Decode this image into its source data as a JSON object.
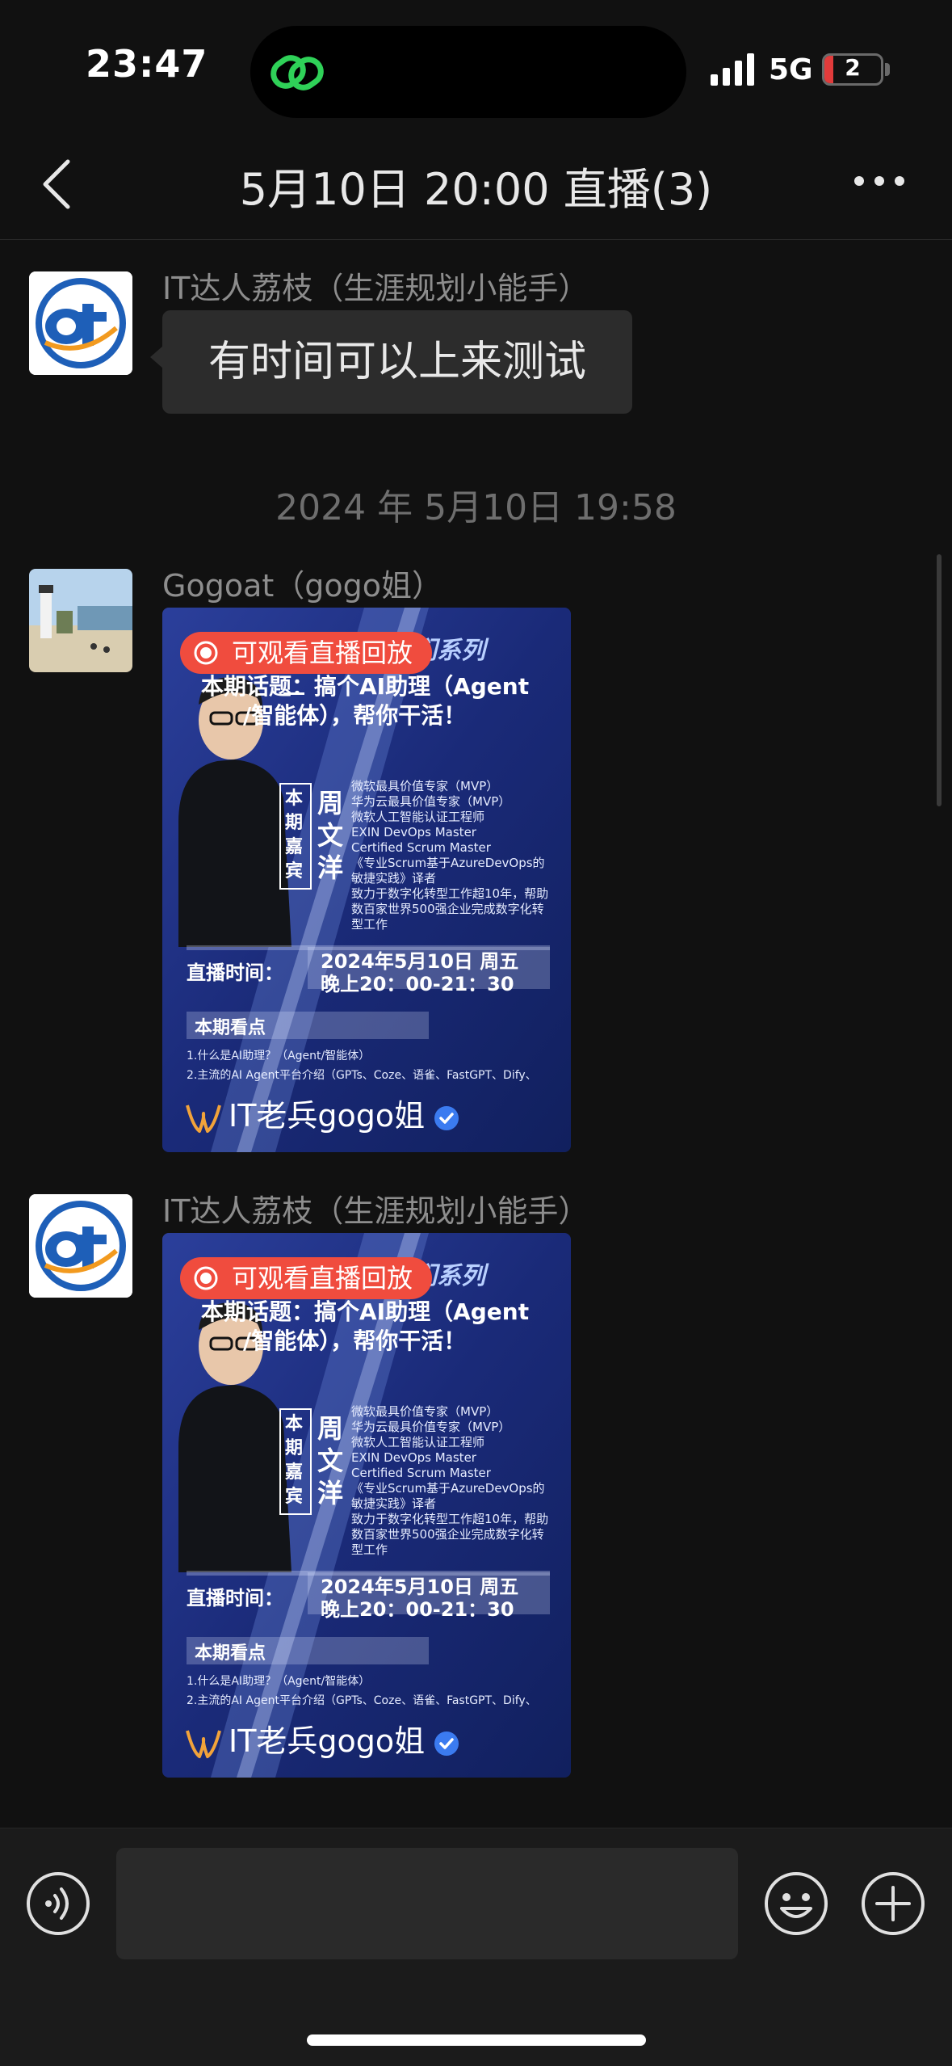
{
  "status_bar": {
    "time": "23:47",
    "network": "5G",
    "battery": "2",
    "battery_level": 0.15
  },
  "nav": {
    "title": "5月10日 20:00 直播(3)"
  },
  "messages": [
    {
      "sender": "IT达人荔枝（生涯规划小能手）",
      "text": "有时间可以上来测试"
    },
    {
      "sender": "Gogoat（gogo姐）"
    },
    {
      "sender": "IT达人荔枝（生涯规划小能手）"
    }
  ],
  "timestamp": "2024 年 5月10日 19:58",
  "card": {
    "badge": "可观看直播回放",
    "channel": "IT老兵gogo姐",
    "poster_series": "大咖朋友们系列",
    "poster_topic_1": "本期话题：搞个AI助理（Agent",
    "poster_topic_2": "/智能体），帮你干活！",
    "poster_guest_tag": "本期嘉宾",
    "poster_guest_name": "周文洋",
    "poster_bio": [
      "微软最具价值专家（MVP）",
      "华为云最具价值专家（MVP）",
      "微软人工智能认证工程师",
      "EXIN DevOps Master",
      "Certified Scrum Master",
      "《专业Scrum基于AzureDevOps的",
      "敏捷实践》译者",
      "致力于数字化转型工作超10年，帮助",
      "数百家世界500强企业完成数字化转",
      "型工作"
    ],
    "poster_time_label": "直播时间：",
    "poster_time_1": "2024年5月10日 周五",
    "poster_time_2": "晚上20：00-21：30",
    "poster_highlights": "本期看点",
    "poster_point_1": "1.什么是AI助理？（Agent/智能体）",
    "poster_point_2": "2.主流的AI Agent平台介绍（GPTs、Coze、语雀、FastGPT、Dify、"
  },
  "icons": {
    "back": "chevron-left-icon",
    "more": "more-dots-icon",
    "voice": "voice-icon",
    "emoji": "emoji-icon",
    "plus": "plus-icon"
  },
  "colors": {
    "background": "#111111",
    "bubble": "#2c2c2c",
    "badge": "#f04c3e",
    "accent": "#3b7bf0"
  }
}
